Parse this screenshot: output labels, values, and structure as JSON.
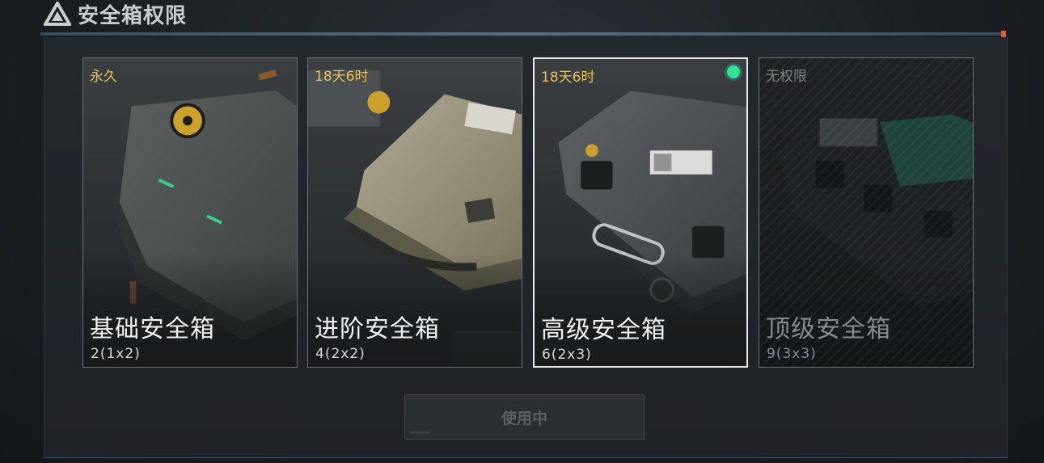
{
  "header": {
    "title": "安全箱权限",
    "icon": "delta-logo-icon"
  },
  "cards": [
    {
      "duration": "永久",
      "name": "基础安全箱",
      "capacity": "2(1x2)",
      "state": "available"
    },
    {
      "duration": "18天6时",
      "name": "进阶安全箱",
      "capacity": "4(2x2)",
      "state": "available"
    },
    {
      "duration": "18天6时",
      "name": "高级安全箱",
      "capacity": "6(2x3)",
      "state": "selected"
    },
    {
      "duration": "无权限",
      "name": "顶级安全箱",
      "capacity": "9(3x3)",
      "state": "locked"
    }
  ],
  "action": {
    "label": "使用中",
    "enabled": false
  },
  "colors": {
    "duration": "#e7c35c",
    "active_dot": "#2fe29a",
    "accent_line": "#5f7f96",
    "accent_orange": "#e85a2c"
  }
}
